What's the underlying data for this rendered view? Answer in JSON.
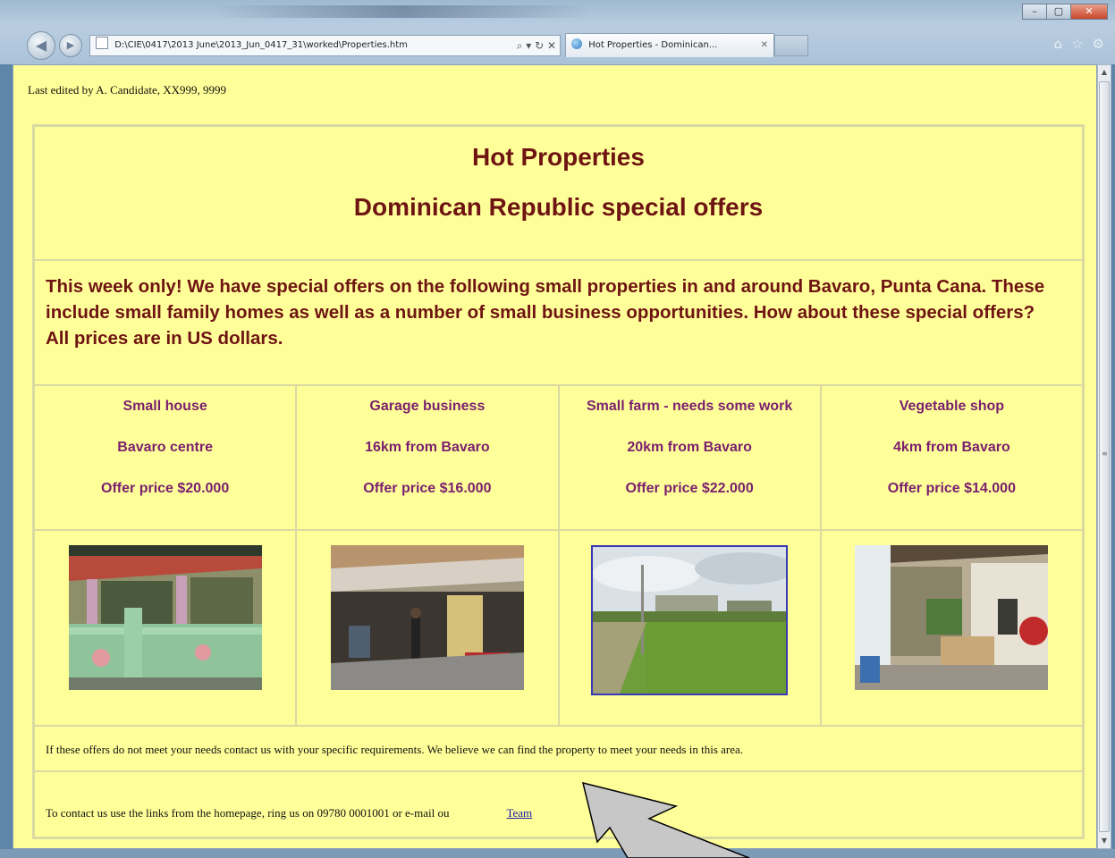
{
  "browser": {
    "address": "D:\\CIE\\0417\\2013 June\\2013_Jun_0417_31\\worked\\Properties.htm",
    "address_tools": "⌕ ▾ ↻ ✕",
    "tab_title": "Hot Properties - Dominican...",
    "tab_close": "✕",
    "back_icon": "arrow-left-icon",
    "forward_icon": "arrow-right-icon",
    "right_icons": [
      "⌂",
      "☆",
      "⚙"
    ],
    "window_buttons": [
      "–",
      "▢",
      "✕"
    ]
  },
  "page": {
    "edited_by": "Last edited by A. Candidate, XX999, 9999",
    "title": "Hot Properties",
    "subtitle": "Dominican Republic special offers",
    "intro": "This week only! We have special offers on the following small properties in and around Bavaro, Punta Cana. These include small family homes as well as a number of small business opportunities. How about these special offers? All prices are in US dollars.",
    "offers": [
      {
        "title": "Small house",
        "location": "Bavaro centre",
        "price": "Offer price $20.000"
      },
      {
        "title": "Garage business",
        "location": "16km from Bavaro",
        "price": "Offer price $16.000"
      },
      {
        "title": "Small farm - needs some work",
        "location": "20km from Bavaro",
        "price": "Offer price $22.000"
      },
      {
        "title": "Vegetable shop",
        "location": "4km from Bavaro",
        "price": "Offer price $14.000"
      }
    ],
    "footer_note": "If these offers do not meet your needs contact us with your specific requirements. We believe we can find the property to meet your needs in this area.",
    "contact_text": "To contact us use the links from the homepage, ring us on 09780 0001001 or e-mail ou",
    "contact_link": "Team"
  },
  "colors": {
    "page_bg": "#ffff99",
    "heading": "#6e1412",
    "offer_text": "#7a1f6e",
    "link": "#1a1aa8"
  }
}
